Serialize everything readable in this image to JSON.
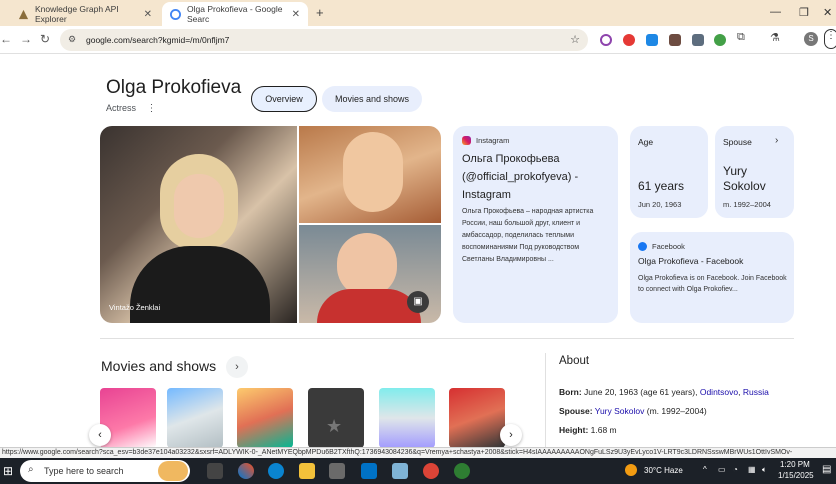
{
  "browser": {
    "tabs": [
      {
        "title": "Knowledge Graph API Explorer"
      },
      {
        "title": "Olga Prokofieva - Google Searc"
      }
    ],
    "url": "google.com/search?kgmid=/m/0nfljm7",
    "status_url": "https://www.google.com/search?sca_esv=b3de37e104a03232&sxsrf=ADLYWIK-0-_ANetMYEQbpMPDu6B2TXfthQ:1736943084236&q=Vremya+schastya+2008&stick=H4sIAAAAAAAAAONgFuLSz9U3yEvLyco1V-LRT9c3LDRNSsswMBrWUs1OttIvSMOv-"
  },
  "entity": {
    "name": "Olga Prokofieva",
    "type": "Actress",
    "tabs": [
      "Overview",
      "Movies and shows"
    ],
    "photo_credit": "Vintažo Ženklai"
  },
  "instagram_card": {
    "source": "Instagram",
    "title": "Ольга Прокофьева (@official_prokofyeva) - Instagram",
    "snippet": "Ольга Прокофьева – народная артистка России, наш большой друг, клиент и амбассадор, поделилась теплыми воспоминаниями Под руководством Светланы Владимировны ..."
  },
  "age_card": {
    "label": "Age",
    "value": "61 years",
    "sub": "Jun 20, 1963"
  },
  "spouse_card": {
    "label": "Spouse",
    "value": "Yury Sokolov",
    "sub": "m. 1992–2004"
  },
  "facebook_card": {
    "source": "Facebook",
    "title": "Olga Prokofieva - Facebook",
    "snippet": "Olga Prokofieva is on Facebook. Join Facebook to connect with Olga Prokofiev..."
  },
  "movies": {
    "heading": "Movies and shows",
    "poster_count_label": "7"
  },
  "about": {
    "heading": "About",
    "born_label": "Born:",
    "born_value": "June 20, 1963 (age 61 years),",
    "born_place1": "Odintsovo",
    "born_place2": "Russia",
    "spouse_label": "Spouse:",
    "spouse_name": "Yury Sokolov",
    "spouse_years": "(m. 1992–2004)",
    "height_label": "Height:",
    "height_value": "1.68 m"
  },
  "taskbar": {
    "search_placeholder": "Type here to search",
    "weather": "30°C  Haze",
    "time": "1:20 PM",
    "date": "1/15/2025"
  },
  "colors": {
    "accent": "#1a0dab",
    "card_bg": "#e8eefc",
    "tab_strip": "#f5e6cf"
  }
}
